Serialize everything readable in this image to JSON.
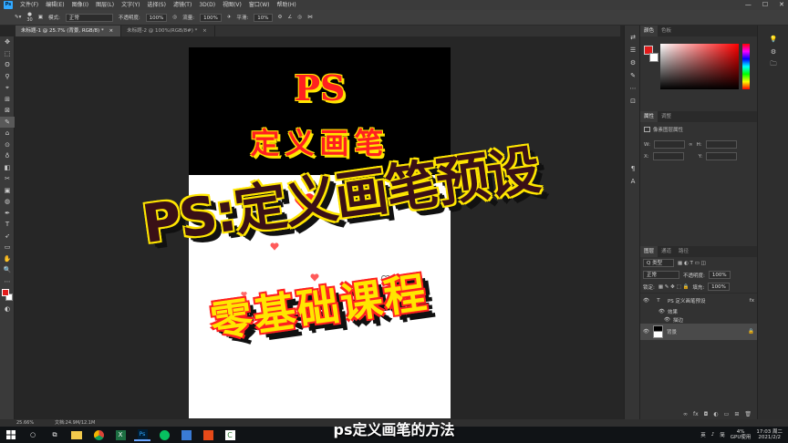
{
  "app": {
    "logo": "Ps"
  },
  "menu": [
    "文件(F)",
    "编辑(E)",
    "图像(I)",
    "图层(L)",
    "文字(Y)",
    "选择(S)",
    "滤镜(T)",
    "3D(D)",
    "视图(V)",
    "窗口(W)",
    "帮助(H)"
  ],
  "window_controls": [
    "—",
    "☐",
    "✕"
  ],
  "options": {
    "brush_size": "30",
    "mode_label": "模式:",
    "mode_value": "正常",
    "opacity_label": "不透明度:",
    "opacity_value": "100%",
    "flow_label": "流量:",
    "flow_value": "100%",
    "smooth_label": "平滑:",
    "smooth_value": "10%"
  },
  "tabs": [
    {
      "label": "未标题-1 @ 25.7% (背景, RGB/8) *",
      "close": "×"
    },
    {
      "label": "未标题-2 @ 100%(RGB/8#) *",
      "close": "×"
    }
  ],
  "tools": [
    "✥",
    "⬚",
    "ʘ",
    "⚲",
    "⌖",
    "⊞",
    "⊠",
    "✎",
    "⌂",
    "⊙",
    "♁",
    "◧",
    "✂",
    "▣",
    "◍",
    "✒",
    "T",
    "➶",
    "▭",
    "✋",
    "🔍",
    "⋯",
    "◐"
  ],
  "canvas": {
    "top_title": "PS",
    "top_subtitle": "定义画笔",
    "headline": "PS:定义画笔预设",
    "course": "零基础课程",
    "colors": {
      "red": "#ff2020",
      "yellow": "#ffe600",
      "dark": "#3a1016"
    }
  },
  "right_strip_icons": [
    "⇄",
    "☰",
    "⚙",
    "✎",
    "⋯",
    "⊡",
    "¶",
    "A"
  ],
  "color_panel": {
    "tabs": [
      "颜色",
      "色板"
    ]
  },
  "props_panel": {
    "tabs": [
      "属性",
      "调整"
    ],
    "heading": "像素图层属性",
    "w_label": "W:",
    "w_value": "",
    "h_label": "H:",
    "h_value": "",
    "x_label": "X:",
    "x_value": "",
    "y_label": "Y:",
    "y_value": ""
  },
  "layers_panel": {
    "tabs": [
      "图层",
      "通道",
      "路径"
    ],
    "filter_label": "Q 类型",
    "blend": "正常",
    "opacity_label": "不透明度:",
    "opacity_value": "100%",
    "lock_label": "锁定:",
    "fill_label": "填充:",
    "fill_value": "100%",
    "layers": [
      {
        "name": "PS 定义画笔预设",
        "type": "T",
        "fx": "fx"
      },
      {
        "name": "效果",
        "sub": true
      },
      {
        "name": "描边",
        "sub": true
      },
      {
        "name": "背景",
        "type": "img",
        "lock": "🔒"
      }
    ]
  },
  "rightmost_icons": [
    "💡",
    "⚙",
    "🗀",
    "T",
    "¶"
  ],
  "status": {
    "zoom": "25.66%",
    "doc": "文档:24.9M/12.1M"
  },
  "subtitle": "ps定义画笔的方法",
  "taskbar": {
    "tray": {
      "ime": "英",
      "sym": "♪",
      "lang": "简",
      "cpu": "4%",
      "cpu_label": "GPU使用",
      "time": "17:03 周二",
      "date": "2021/2/2"
    }
  }
}
